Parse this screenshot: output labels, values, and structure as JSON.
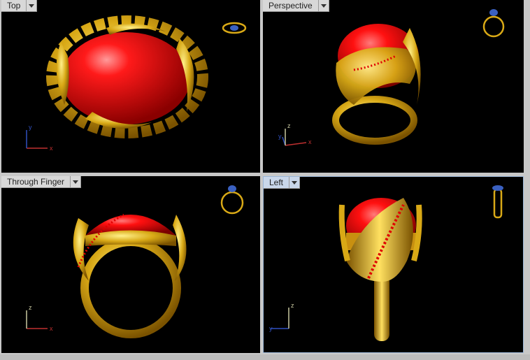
{
  "viewports": [
    {
      "title": "Top",
      "axes": {
        "vertical": "y",
        "horizontal": "x"
      }
    },
    {
      "title": "Perspective",
      "axes": {
        "vertical": "z",
        "horizontal": "x"
      }
    },
    {
      "title": "Through Finger",
      "axes": {
        "vertical": "z",
        "horizontal": "x"
      }
    },
    {
      "title": "Left",
      "axes": {
        "vertical": "z",
        "horizontal": "y"
      }
    }
  ],
  "active_viewport": "Left",
  "colors": {
    "gold": "#d9a916",
    "gold_dark": "#8a6200",
    "gem_red": "#e00000",
    "gem_highlight": "#ff8080",
    "background": "#000000",
    "axis_x": "#c03030",
    "axis_y": "#3050c0",
    "axis_z": "#c8c8a0"
  },
  "icons": [
    "menu-dropdown-icon",
    "ring-widget-icon"
  ]
}
